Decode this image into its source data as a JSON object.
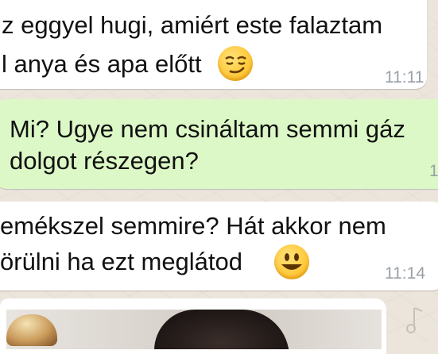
{
  "messages": [
    {
      "direction": "incoming",
      "lines": [
        "z eggyel hugi, amiért este falaztam",
        "l anya és apa előtt"
      ],
      "emoji": "smirking-face",
      "time": "11:11"
    },
    {
      "direction": "outgoing",
      "lines": [
        "Mi? Ugye nem csináltam semmi gáz",
        "dolgot részegen?"
      ],
      "time": "1"
    },
    {
      "direction": "incoming",
      "lines": [
        "emékszel semmire? Hát akkor nem",
        "örülni ha ezt meglátod"
      ],
      "emoji": "grinning-face",
      "time": "11:14"
    }
  ],
  "colors": {
    "wallpaper": "#ece5dc",
    "incoming_bubble": "#ffffff",
    "outgoing_bubble": "#dcf8c6",
    "timestamp": "#9aa0a6"
  }
}
